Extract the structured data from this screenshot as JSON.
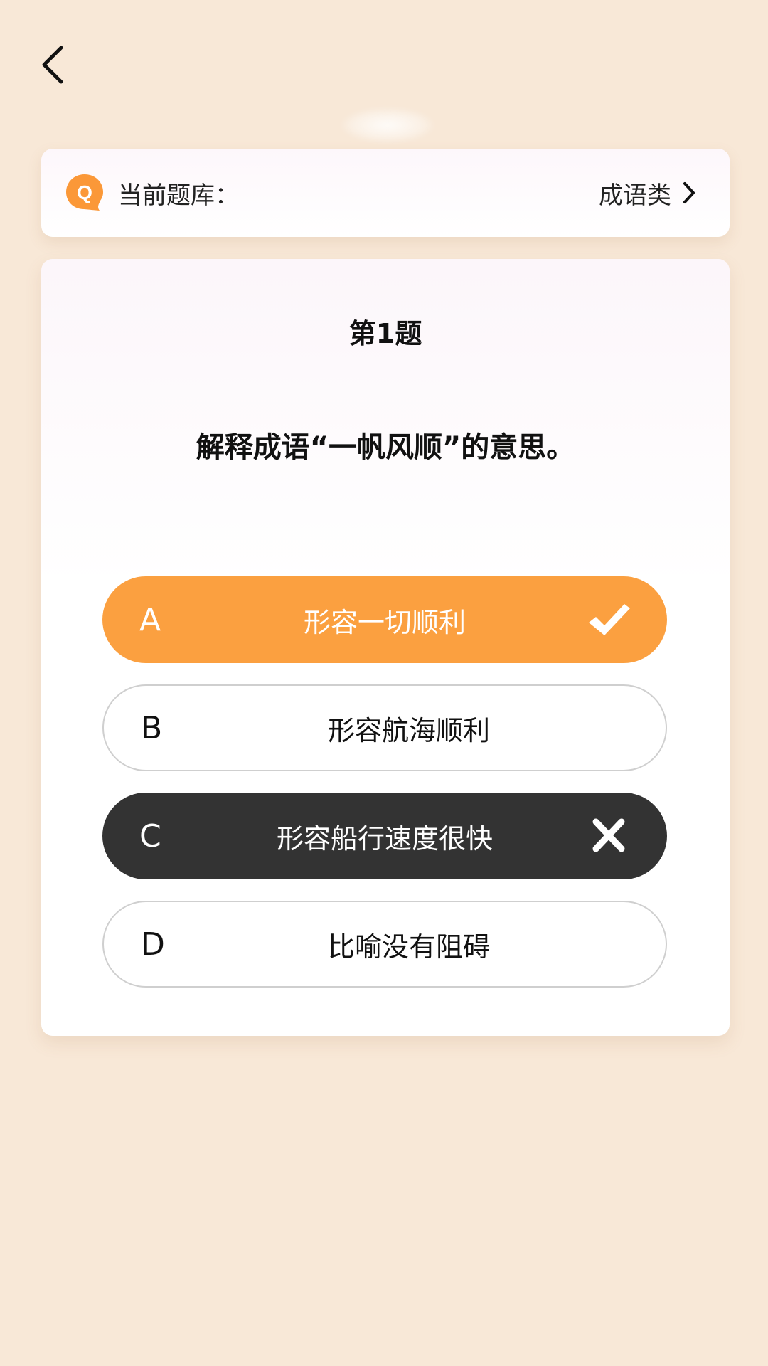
{
  "header": {
    "back_icon": "chevron-left-icon"
  },
  "question_bank": {
    "icon": "q-chat-badge-icon",
    "label": "当前题库：",
    "value": "成语类",
    "chevron_icon": "chevron-right-icon"
  },
  "question": {
    "number": "第1题",
    "text": "解释成语“一帆风顺”的意思。",
    "options": [
      {
        "letter": "A",
        "text": "形容一切顺利",
        "state": "correct",
        "mark_icon": "check-icon"
      },
      {
        "letter": "B",
        "text": "形容航海顺利",
        "state": "unselected"
      },
      {
        "letter": "C",
        "text": "形容船行速度很快",
        "state": "wrong",
        "mark_icon": "cross-icon"
      },
      {
        "letter": "D",
        "text": "比喻没有阻碍",
        "state": "unselected"
      }
    ]
  },
  "colors": {
    "background": "#f8e8d7",
    "correct": "#fba040",
    "wrong": "#333333",
    "badge": "#fb9838"
  }
}
